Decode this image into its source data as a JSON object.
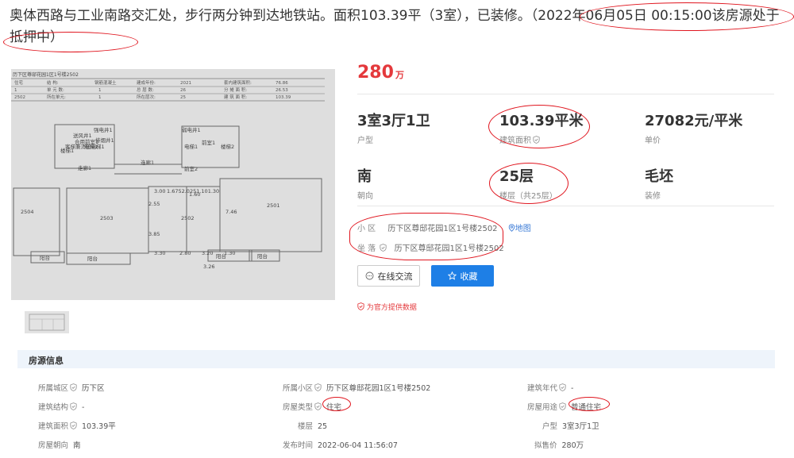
{
  "headline": "奥体西路与工业南路交汇处，步行两分钟到达地铁站。面积103.39平（3室），已装修。（2022年06月05日 00:15:00该房源处于抵押中）",
  "price": {
    "value": "280",
    "unit": "万"
  },
  "stats": [
    {
      "value": "3室3厅1卫",
      "label": "户型"
    },
    {
      "value": "103.39平米",
      "label": "建筑面积"
    },
    {
      "value": "27082元/平米",
      "label": "单价"
    },
    {
      "value": "南",
      "label": "朝向"
    },
    {
      "value": "25层",
      "label": "楼层（共25层）"
    },
    {
      "value": "毛坯",
      "label": "装修"
    }
  ],
  "community": {
    "key": "小 区",
    "value": "历下区尊邸花园1区1号楼2502",
    "map_link": "地图"
  },
  "location": {
    "key": "坐 落",
    "value": "历下区尊邸花园1区1号楼2502"
  },
  "buttons": {
    "chat": "在线交流",
    "favorite": "收藏"
  },
  "official_note": "为官方提供数据",
  "section_title": "房源信息",
  "info": [
    {
      "key": "所属城区",
      "value": "历下区",
      "verified": true
    },
    {
      "key": "所属小区",
      "value": "历下区尊邸花园1区1号楼2502",
      "verified": true
    },
    {
      "key": "建筑年代",
      "value": "-",
      "verified": true
    },
    {
      "key": "建筑结构",
      "value": "-",
      "verified": true
    },
    {
      "key": "房屋类型",
      "value": "住宅",
      "verified": true
    },
    {
      "key": "房屋用途",
      "value": "普通住宅",
      "verified": true
    },
    {
      "key": "建筑面积",
      "value": "103.39平",
      "verified": true
    },
    {
      "key": "楼层",
      "value": "25",
      "verified": false
    },
    {
      "key": "户型",
      "value": "3室3厅1卫",
      "verified": false
    },
    {
      "key": "房屋朝向",
      "value": "南",
      "verified": false
    },
    {
      "key": "发布时间",
      "value": "2022-06-04 11:56:07",
      "verified": false
    },
    {
      "key": "拟售价",
      "value": "280万",
      "verified": false
    }
  ],
  "floorplan": {
    "header_line": "历下区尊邸花园1区1号楼2502",
    "table": [
      [
        "住宅",
        "结 构:",
        "钢筋混凝土",
        "建成年份:",
        "2021",
        "套内建筑面积:",
        "76.86"
      ],
      [
        "1",
        "单 元 数:",
        "1",
        "总 层 数:",
        "26",
        "分 摊 面 积:",
        "26.53"
      ],
      [
        "2502",
        "所在单元:",
        "1",
        "所在层次:",
        "25",
        "建 筑 面 积:",
        "103.39"
      ]
    ],
    "rooms": [
      "2504",
      "2503",
      "2502",
      "2501",
      "楼梯1",
      "连廊1",
      "电梯1",
      "电梯1",
      "走廊1",
      "前室1",
      "楼梯2",
      "前室2",
      "阳台",
      "阳台",
      "阳台",
      "阳台",
      "送风井1",
      "合用前室1",
      "强电井1",
      "弱电井1",
      "排烟井1",
      "客梯兼消防电梯1",
      "3.00",
      "3.30",
      "2.80",
      "3.20",
      "3.26",
      "1.30",
      "1.60",
      "2.55",
      "3.85",
      "7.46",
      "1.6752.0251.101.30"
    ]
  },
  "colors": {
    "accent": "#e4393c",
    "button": "#1e7fe6",
    "link": "#3b7bd6",
    "annotation": "#e0151e",
    "section_bg": "#eef4fb"
  }
}
